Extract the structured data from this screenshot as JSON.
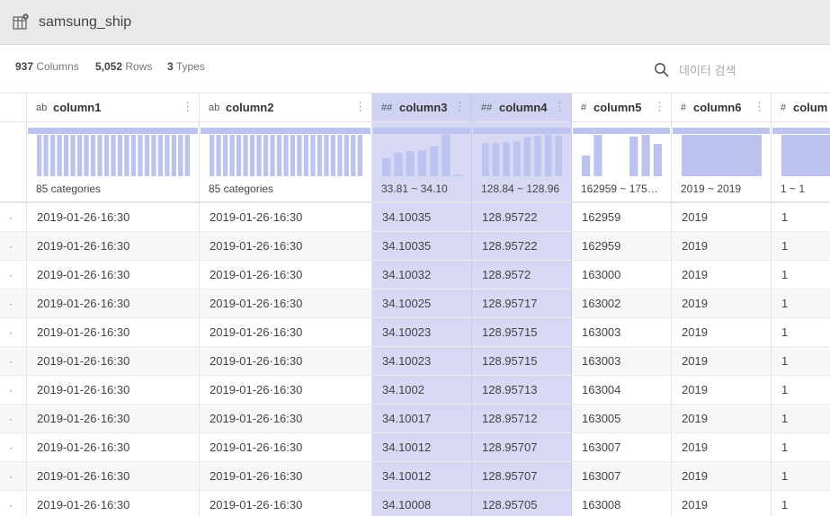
{
  "dataset": {
    "title": "samsung_ship",
    "icon": "dataset-icon"
  },
  "stats": [
    {
      "value": "937",
      "label": "Columns"
    },
    {
      "value": "5,052",
      "label": "Rows"
    },
    {
      "value": "3",
      "label": "Types"
    }
  ],
  "search": {
    "placeholder": "데이터 검색",
    "icon": "search-icon"
  },
  "columns": [
    {
      "key": "c1",
      "type": "ab",
      "name": "column1",
      "range": "85 categories",
      "selected": false,
      "hist": [
        1,
        1,
        1,
        1,
        1,
        1,
        1,
        1,
        1,
        1,
        1,
        1,
        1,
        1,
        1,
        1,
        1,
        1,
        1,
        1,
        1,
        1,
        1
      ]
    },
    {
      "key": "c2",
      "type": "ab",
      "name": "column2",
      "range": "85 categories",
      "selected": false,
      "hist": [
        1,
        1,
        1,
        1,
        1,
        1,
        1,
        1,
        1,
        1,
        1,
        1,
        1,
        1,
        1,
        1,
        1,
        1,
        1,
        1,
        1,
        1,
        1
      ]
    },
    {
      "key": "c3",
      "type": "##",
      "name": "column3",
      "range": "33.81 ~ 34.10",
      "selected": true,
      "hist": [
        0.44,
        0.56,
        0.6,
        0.62,
        0.72,
        1,
        0.02
      ]
    },
    {
      "key": "c4",
      "type": "##",
      "name": "column4",
      "range": "128.84 ~ 128.96",
      "selected": true,
      "hist": [
        0.8,
        0.8,
        0.82,
        0.84,
        0.94,
        0.98,
        1,
        0.98
      ]
    },
    {
      "key": "c5",
      "type": "#",
      "name": "column5",
      "range": "162959 ~ 175…",
      "selected": false,
      "hist": [
        0.5,
        1,
        0,
        0,
        0.96,
        1,
        0.78
      ]
    },
    {
      "key": "c6",
      "type": "#",
      "name": "column6",
      "range": "2019 ~ 2019",
      "selected": false,
      "hist": [
        1
      ]
    },
    {
      "key": "c7",
      "type": "#",
      "name": "colum",
      "range": "1 ~ 1",
      "selected": false,
      "hist": [
        1
      ]
    }
  ],
  "rows": [
    {
      "c1": "2019-01-26·16:30",
      "c2": "2019-01-26·16:30",
      "c3": "34.10035",
      "c4": "128.95722",
      "c5": "162959",
      "c6": "2019",
      "c7": "1"
    },
    {
      "c1": "2019-01-26·16:30",
      "c2": "2019-01-26·16:30",
      "c3": "34.10035",
      "c4": "128.95722",
      "c5": "162959",
      "c6": "2019",
      "c7": "1"
    },
    {
      "c1": "2019-01-26·16:30",
      "c2": "2019-01-26·16:30",
      "c3": "34.10032",
      "c4": "128.9572",
      "c5": "163000",
      "c6": "2019",
      "c7": "1"
    },
    {
      "c1": "2019-01-26·16:30",
      "c2": "2019-01-26·16:30",
      "c3": "34.10025",
      "c4": "128.95717",
      "c5": "163002",
      "c6": "2019",
      "c7": "1"
    },
    {
      "c1": "2019-01-26·16:30",
      "c2": "2019-01-26·16:30",
      "c3": "34.10023",
      "c4": "128.95715",
      "c5": "163003",
      "c6": "2019",
      "c7": "1"
    },
    {
      "c1": "2019-01-26·16:30",
      "c2": "2019-01-26·16:30",
      "c3": "34.10023",
      "c4": "128.95715",
      "c5": "163003",
      "c6": "2019",
      "c7": "1"
    },
    {
      "c1": "2019-01-26·16:30",
      "c2": "2019-01-26·16:30",
      "c3": "34.1002",
      "c4": "128.95713",
      "c5": "163004",
      "c6": "2019",
      "c7": "1"
    },
    {
      "c1": "2019-01-26·16:30",
      "c2": "2019-01-26·16:30",
      "c3": "34.10017",
      "c4": "128.95712",
      "c5": "163005",
      "c6": "2019",
      "c7": "1"
    },
    {
      "c1": "2019-01-26·16:30",
      "c2": "2019-01-26·16:30",
      "c3": "34.10012",
      "c4": "128.95707",
      "c5": "163007",
      "c6": "2019",
      "c7": "1"
    },
    {
      "c1": "2019-01-26·16:30",
      "c2": "2019-01-26·16:30",
      "c3": "34.10012",
      "c4": "128.95707",
      "c5": "163007",
      "c6": "2019",
      "c7": "1"
    },
    {
      "c1": "2019-01-26·16:30",
      "c2": "2019-01-26·16:30",
      "c3": "34.10008",
      "c4": "128.95705",
      "c5": "163008",
      "c6": "2019",
      "c7": "1"
    }
  ],
  "row_marker": "·",
  "colors": {
    "bar": "#bcc3ee",
    "selected": "#d6d8f4",
    "header_bg": "#e9e9eb"
  }
}
